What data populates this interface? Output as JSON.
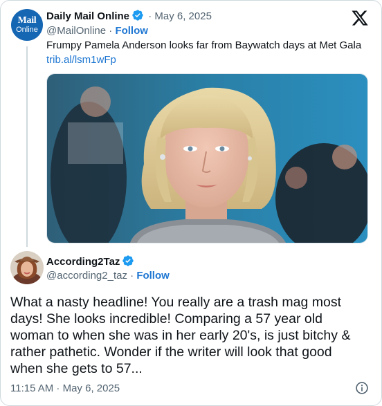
{
  "quoted": {
    "author_name": "Daily Mail Online",
    "date": "May 6, 2025",
    "handle": "@MailOnline",
    "follow_label": "Follow",
    "text": "Frumpy Pamela Anderson looks far from Baywatch days at Met Gala",
    "link": "trib.al/lsm1wFp",
    "avatar_line1": "Mail",
    "avatar_line2": "Online"
  },
  "reply": {
    "author_name": "According2Taz",
    "handle": "@according2_taz",
    "follow_label": "Follow",
    "text": "What a nasty headline! You really are a trash mag most days! She looks incredible! Comparing a 57 year old woman to when she was in her early 20's, is just bitchy & rather pathetic. Wonder if the writer will look that good when she gets to 57...",
    "timestamp": "11:15 AM · May 6, 2025"
  },
  "separator": "·",
  "colors": {
    "link": "#1d76d2",
    "verified": "#1d9bf0",
    "muted": "#536471",
    "text": "#0f1419",
    "dm_avatar_bg": "#1566b3"
  },
  "icons": [
    "x-logo-icon",
    "verified-badge-icon",
    "info-icon"
  ]
}
